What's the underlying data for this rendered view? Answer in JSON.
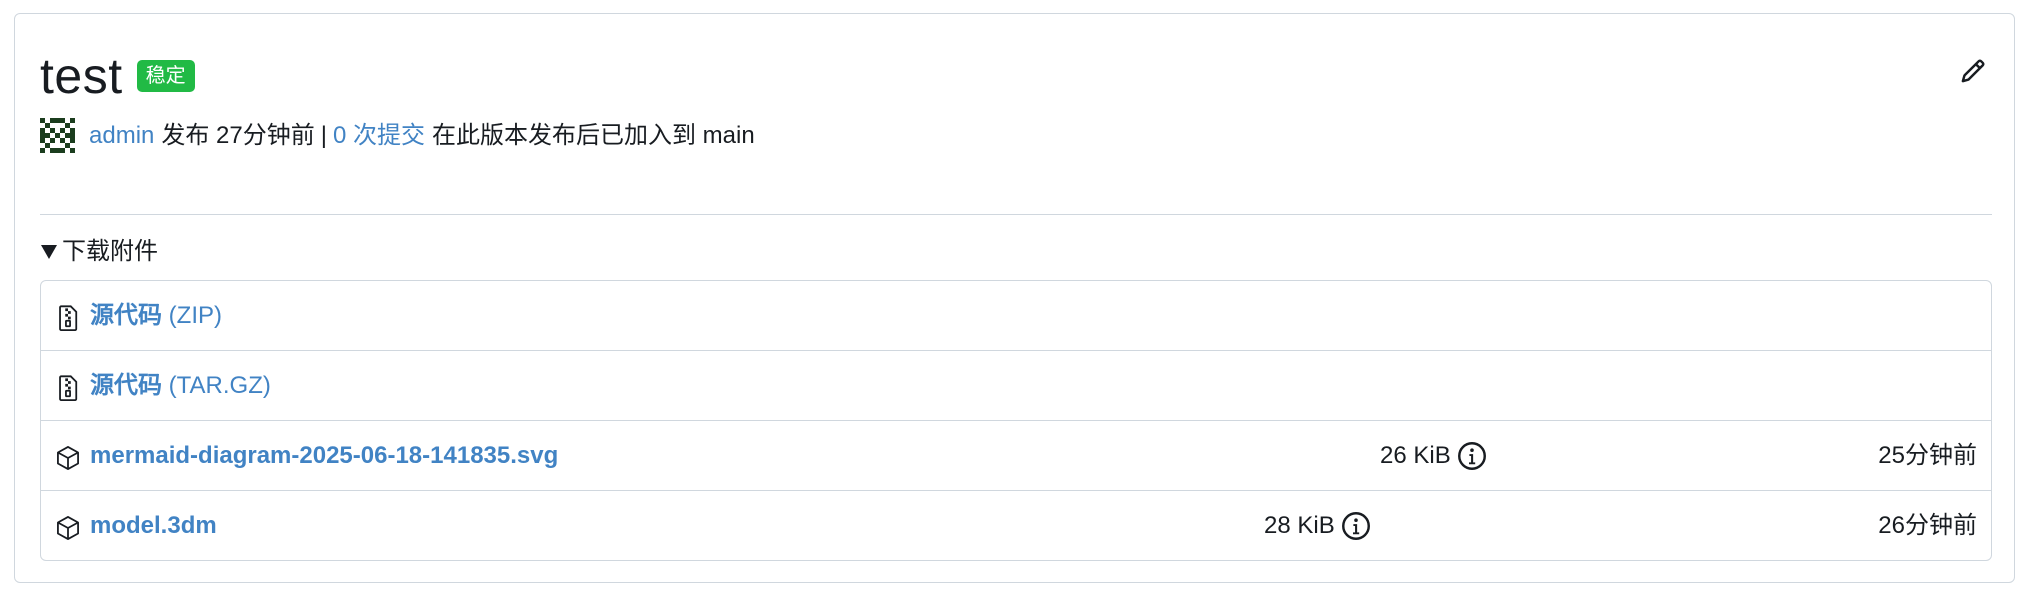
{
  "release": {
    "title": "test",
    "badge": "稳定",
    "author": "admin",
    "published_text": "发布 27分钟前",
    "separator": "|",
    "commits_link": "0 次提交",
    "commits_suffix": "在此版本发布后已加入到 main"
  },
  "downloads": {
    "summary_label": "下载附件",
    "expanded": true,
    "source_archives": [
      {
        "name": "源代码",
        "format": "(ZIP)",
        "icon": "file-zip-icon"
      },
      {
        "name": "源代码",
        "format": "(TAR.GZ)",
        "icon": "file-zip-icon"
      }
    ],
    "attachments": [
      {
        "name": "mermaid-diagram-2025-06-18-141835.svg",
        "size": "26 KiB",
        "time": "25分钟前",
        "icon": "package-icon"
      },
      {
        "name": "model.3dm",
        "size": "28 KiB",
        "time": "26分钟前",
        "icon": "package-icon"
      }
    ]
  },
  "colors": {
    "link": "#4183c4",
    "badge": "#21ba45",
    "border": "#d0d7de",
    "text": "#181c21"
  },
  "icons": {
    "edit": "pencil-icon",
    "info": "info-icon",
    "avatar": "identicon-avatar"
  }
}
